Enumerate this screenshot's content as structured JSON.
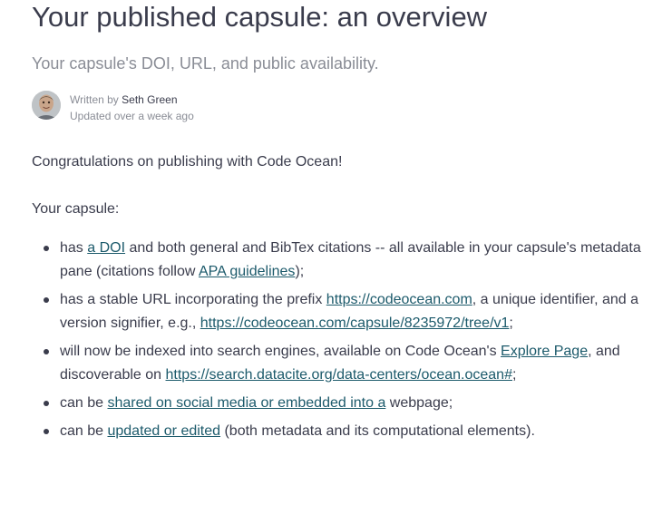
{
  "article": {
    "title": "Your published capsule: an overview",
    "subtitle": "Your capsule's DOI, URL, and public availability.",
    "author": {
      "written_by_prefix": "Written by",
      "name": "Seth Green",
      "updated": "Updated over a week ago"
    },
    "intro": "Congratulations on publishing with Code Ocean!",
    "lead": "Your capsule:",
    "bullets": {
      "b1": {
        "t1": "has ",
        "link1": "a DOI",
        "t2": " and both general and BibTex citations -- all available in your capsule's metadata pane (citations follow ",
        "link2": "APA guidelines",
        "t3": ");"
      },
      "b2": {
        "t1": "has a stable URL incorporating the prefix ",
        "link1": "https://codeocean.com",
        "t2": ", a unique identifier, and a version signifier, e.g., ",
        "link2": "https://codeocean.com/capsule/8235972/tree/v1",
        "t3": ";"
      },
      "b3": {
        "t1": "will now be indexed into search engines, available on Code Ocean's ",
        "link1": "Explore Page",
        "t2": ", and discoverable on ",
        "link2": "https://search.datacite.org/data-centers/ocean.ocean#",
        "t3": ";"
      },
      "b4": {
        "t1": "can be ",
        "link1": "shared on social media or embedded into a",
        "t2": " webpage;"
      },
      "b5": {
        "t1": "can be ",
        "link1": "updated or edited",
        "t2": " (both metadata and its computational elements)."
      }
    }
  },
  "colors": {
    "text": "#3a3c4c",
    "muted": "#8a8d96",
    "link": "#1c5a6b"
  }
}
